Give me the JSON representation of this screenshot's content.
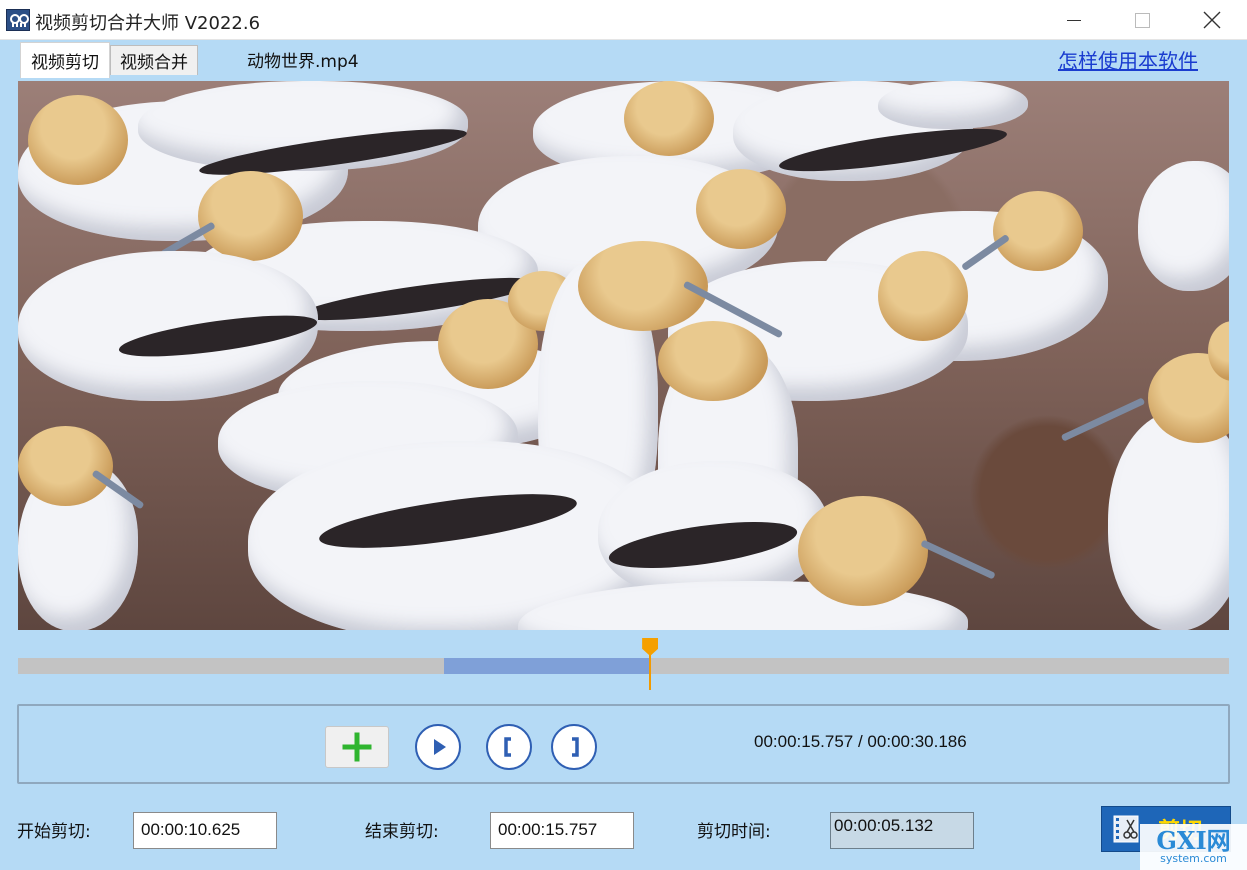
{
  "window": {
    "title": "视频剪切合并大师 V2022.6",
    "app_icon": "film-reel-icon"
  },
  "tabs": [
    {
      "label": "视频剪切",
      "selected": true
    },
    {
      "label": "视频合并",
      "selected": false
    }
  ],
  "file": {
    "name": "动物世界.mp4"
  },
  "help": {
    "label": "怎样使用本软件"
  },
  "timeline": {
    "current_time": "00:00:15.757",
    "total_time": "00:00:30.186",
    "selection_start": "00:00:10.625",
    "selection_end": "00:00:15.757",
    "colors": {
      "track": "#c3c3c3",
      "selection": "#7fa0d8",
      "playhead": "#f29a00"
    }
  },
  "controls": {
    "add_icon": "green-plus-icon",
    "play_icon": "play-icon",
    "mark_in_icon": "left-bracket-icon",
    "mark_out_icon": "right-bracket-icon",
    "time_display": "00:00:15.757 / 00:00:30.186"
  },
  "fields": {
    "start": {
      "label": "开始剪切:",
      "value": "00:00:10.625"
    },
    "end": {
      "label": "结束剪切:",
      "value": "00:00:15.757"
    },
    "duration": {
      "label": "剪切时间:",
      "value": "00:00:05.132"
    }
  },
  "cut_button": {
    "label": "剪切",
    "icon": "scissors-film-icon"
  },
  "watermark": {
    "big": "GXI网",
    "small": "system.com"
  },
  "colors": {
    "client_bg": "#b5daf5",
    "link": "#1a3ccf",
    "cut_button": "#1e66b8",
    "cut_label": "#ffd800"
  }
}
